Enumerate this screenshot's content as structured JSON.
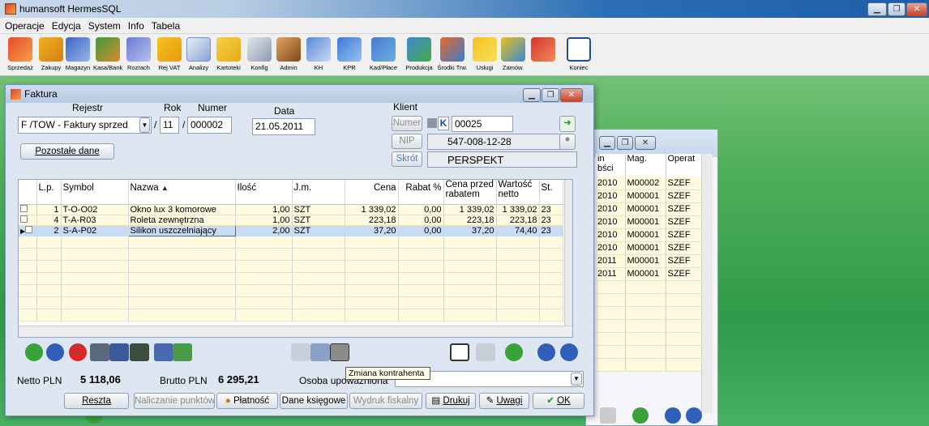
{
  "app": {
    "title": "humansoft HermesSQL"
  },
  "menu": [
    "Operacje",
    "Edycja",
    "System",
    "Info",
    "Tabela"
  ],
  "toolbar": [
    {
      "label": "Sprzedaż",
      "icon": "sales-icon"
    },
    {
      "label": "Zakupy",
      "icon": "cart-icon"
    },
    {
      "label": "Magazyn",
      "icon": "warehouse-icon"
    },
    {
      "label": "Kasa/Bank",
      "icon": "money-bag-icon"
    },
    {
      "label": "Rozrach",
      "icon": "calculator-icon"
    },
    {
      "label": "Rej VAT",
      "icon": "vat-folder-icon"
    },
    {
      "label": "Analizy",
      "icon": "chart-icon"
    },
    {
      "label": "Kartoteki",
      "icon": "folder-icon"
    },
    {
      "label": "Konfig",
      "icon": "tools-icon"
    },
    {
      "label": "Admin",
      "icon": "admin-icon"
    },
    {
      "label": "KH",
      "icon": "ma-wn-icon"
    },
    {
      "label": "KPR",
      "icon": "book-icon"
    },
    {
      "label": "Kad/Płace",
      "icon": "hr-icon"
    },
    {
      "label": "Produkcja",
      "icon": "production-icon"
    },
    {
      "label": "Środki Trw.",
      "icon": "truck-icon"
    },
    {
      "label": "Usługi",
      "icon": "services-icon"
    },
    {
      "label": "Zamów.",
      "icon": "orders-icon"
    },
    {
      "label": "Koniec",
      "icon": "exit-icon"
    }
  ],
  "background_window": {
    "headers": [
      "in\nbści",
      "Mag.",
      "Operat"
    ],
    "rows": [
      [
        "2010",
        "M00002",
        "SZEF"
      ],
      [
        "2010",
        "M00001",
        "SZEF"
      ],
      [
        "2010",
        "M00001",
        "SZEF"
      ],
      [
        "2010",
        "M00001",
        "SZEF"
      ],
      [
        "2010",
        "M00001",
        "SZEF"
      ],
      [
        "2010",
        "M00001",
        "SZEF"
      ],
      [
        "2011",
        "M00001",
        "SZEF"
      ],
      [
        "2011",
        "M00001",
        "SZEF"
      ]
    ]
  },
  "faktura": {
    "title": "Faktura",
    "rejestr_label": "Rejestr",
    "rok_label": "Rok",
    "numer_label": "Numer",
    "data_label": "Data",
    "rejestr": "F /TOW - Faktury sprzed",
    "rok": "11",
    "numer": "000002",
    "data": "21.05.2011",
    "klient_label": "Klient",
    "numer_btn": "Numer",
    "nip_btn": "NIP",
    "skrot_btn": "Skrót",
    "k_badge": "K",
    "klient_numer": "00025",
    "klient_nip": "547-008-12-28",
    "klient_skrot": "PERSPEKT",
    "pozostale_btn": "Pozostałe dane",
    "columns": [
      "L.p.",
      "Symbol",
      "Nazwa",
      "Ilość",
      "J.m.",
      "Cena",
      "Rabat %",
      "Cena przed rabatem",
      "Wartość netto",
      "St."
    ],
    "rows": [
      {
        "lp": "1",
        "symbol": "T-O-O02",
        "nazwa": "Okno lux 3 komorowe",
        "ilosc": "1,00",
        "jm": "SZT",
        "cena": "1 339,02",
        "rabat": "0,00",
        "cena_przed": "1 339,02",
        "wartosc": "1 339,02",
        "st": "23"
      },
      {
        "lp": "4",
        "symbol": "T-A-R03",
        "nazwa": "Roleta zewnętrzna",
        "ilosc": "1,00",
        "jm": "SZT",
        "cena": "223,18",
        "rabat": "0,00",
        "cena_przed": "223,18",
        "wartosc": "223,18",
        "st": "23"
      },
      {
        "lp": "2",
        "symbol": "S-A-P02",
        "nazwa": "Silikon uszczelniający",
        "ilosc": "2,00",
        "jm": "SZT",
        "cena": "37,20",
        "rabat": "0,00",
        "cena_przed": "37,20",
        "wartosc": "74,40",
        "st": "23"
      }
    ],
    "netto_label": "Netto PLN",
    "netto": "5 118,06",
    "brutto_label": "Brutto PLN",
    "brutto": "6 295,21",
    "osoba_label": "Osoba upoważniona",
    "tooltip": "Zmiana kontrahenta",
    "buttons": {
      "reszta": "Reszta",
      "naliczanie": "Naliczanie punktów",
      "platnosc": "Płatność",
      "dane": "Dane księgowe",
      "wydruk": "Wydruk fiskalny",
      "drukuj": "Drukuj",
      "uwagi": "Uwagi",
      "ok": "OK"
    }
  },
  "colors": {
    "desktop": "#4fae5a",
    "grid_row": "#fffbe0",
    "selection": "#c9dcf5",
    "accent_green": "#3a9b3a"
  }
}
